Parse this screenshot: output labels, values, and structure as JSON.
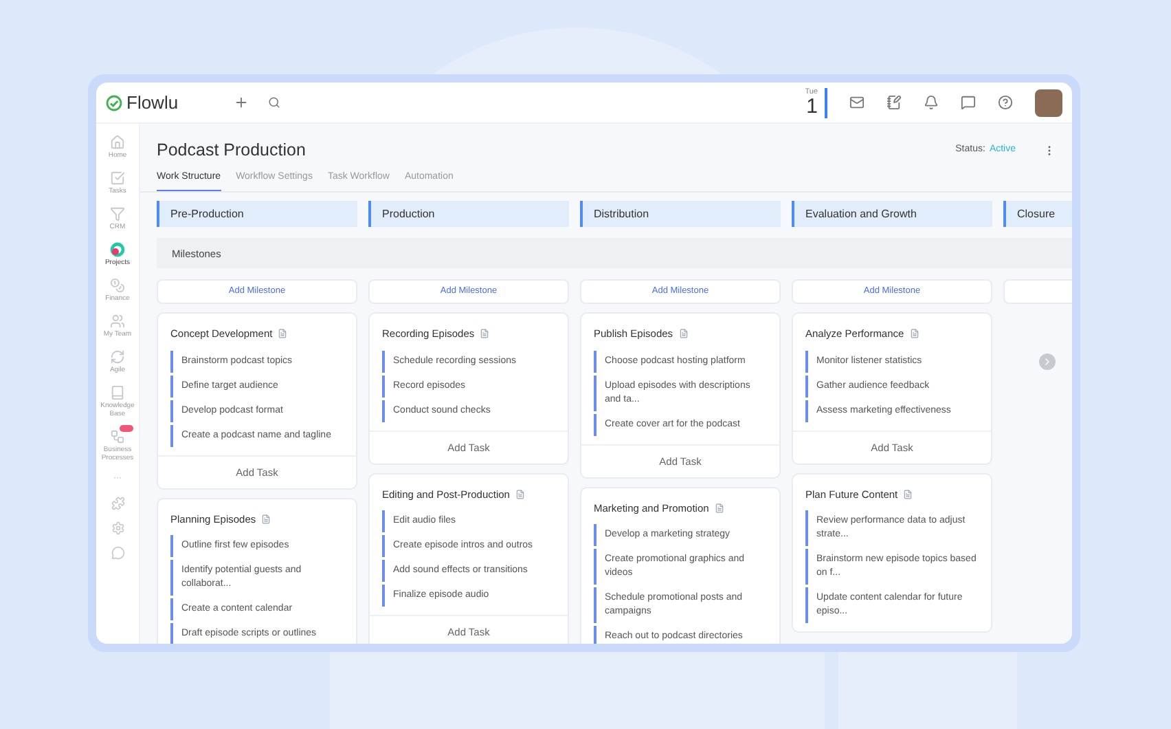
{
  "brand": "Flowlu",
  "date": {
    "weekday": "Tue",
    "day": "1"
  },
  "sidebar": {
    "items": [
      {
        "label": "Home",
        "selected": false
      },
      {
        "label": "Tasks",
        "selected": false
      },
      {
        "label": "CRM",
        "selected": false
      },
      {
        "label": "Projects",
        "selected": true
      },
      {
        "label": "Finance",
        "selected": false
      },
      {
        "label": "My Team",
        "selected": false
      },
      {
        "label": "Agile",
        "selected": false
      },
      {
        "label": "Knowledge Base",
        "selected": false
      },
      {
        "label": "Business Processes",
        "selected": false,
        "badge": true
      }
    ],
    "more": "···"
  },
  "project": {
    "title": "Podcast Production",
    "status_label": "Status:",
    "status_value": "Active"
  },
  "tabs": [
    {
      "label": "Work Structure",
      "selected": true
    },
    {
      "label": "Workflow Settings",
      "selected": false
    },
    {
      "label": "Task Workflow",
      "selected": false
    },
    {
      "label": "Automation",
      "selected": false
    }
  ],
  "milestones_label": "Milestones",
  "stages": [
    {
      "title": "Pre-Production",
      "add_milestone": "Add Milestone",
      "milestones": [
        {
          "title": "Concept Development",
          "tasks": [
            "Brainstorm podcast topics",
            "Define target audience",
            "Develop podcast format",
            "Create a podcast name and tagline"
          ],
          "add_task": "Add Task"
        },
        {
          "title": "Planning Episodes",
          "tasks": [
            "Outline first few episodes",
            "Identify potential guests and collaborat...",
            "Create a content calendar",
            "Draft episode scripts or outlines"
          ]
        }
      ]
    },
    {
      "title": "Production",
      "add_milestone": "Add Milestone",
      "milestones": [
        {
          "title": "Recording Episodes",
          "tasks": [
            "Schedule recording sessions",
            "Record episodes",
            "Conduct sound checks"
          ],
          "add_task": "Add Task"
        },
        {
          "title": "Editing and Post-Production",
          "tasks": [
            "Edit audio files",
            "Create episode intros and outros",
            "Add sound effects or transitions",
            "Finalize episode audio"
          ],
          "add_task": "Add Task"
        }
      ]
    },
    {
      "title": "Distribution",
      "add_milestone": "Add Milestone",
      "milestones": [
        {
          "title": "Publish Episodes",
          "tasks": [
            "Choose podcast hosting platform",
            "Upload episodes with descriptions and ta...",
            "Create cover art for the podcast"
          ],
          "add_task": "Add Task"
        },
        {
          "title": "Marketing and Promotion",
          "tasks": [
            "Develop a marketing strategy",
            "Create promotional graphics and videos",
            "Schedule promotional posts and campaigns",
            "Reach out to podcast directories"
          ]
        }
      ]
    },
    {
      "title": "Evaluation and Growth",
      "add_milestone": "Add Milestone",
      "milestones": [
        {
          "title": "Analyze Performance",
          "tasks": [
            "Monitor listener statistics",
            "Gather audience feedback",
            "Assess marketing effectiveness"
          ],
          "add_task": "Add Task"
        },
        {
          "title": "Plan Future Content",
          "tasks": [
            "Review performance data to adjust strate...",
            "Brainstorm new episode topics based on f...",
            "Update content calendar for future episo..."
          ]
        }
      ]
    },
    {
      "title": "Closure"
    }
  ]
}
